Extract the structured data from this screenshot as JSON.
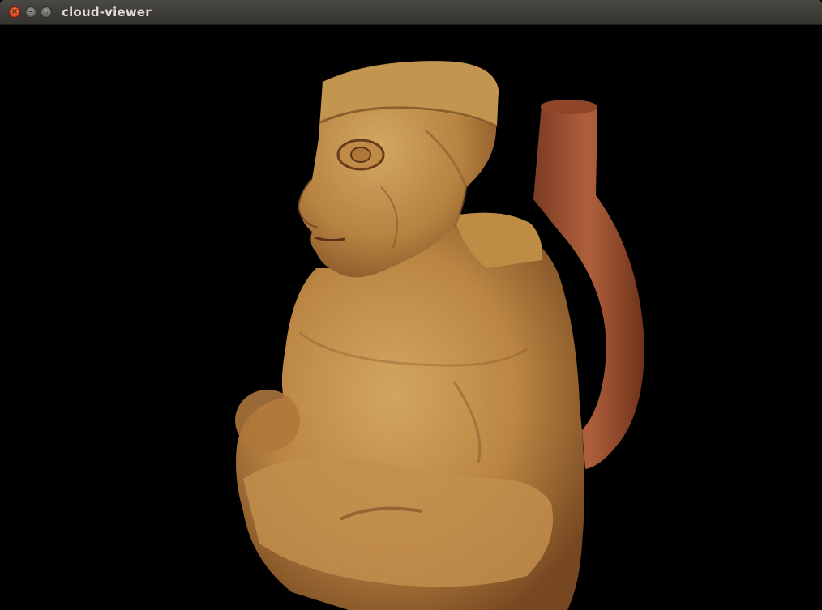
{
  "window": {
    "title": "cloud-viewer",
    "buttons": {
      "close_icon": "close-icon",
      "minimize_icon": "minimize-icon",
      "maximize_icon": "maximize-icon"
    }
  },
  "viewport": {
    "background": "#000000",
    "content": "point-cloud-render",
    "colors": {
      "clay_light": "#d3a55a",
      "clay_mid": "#b9813f",
      "clay_dark": "#7a4a22",
      "handle": "#a65a3a"
    }
  }
}
